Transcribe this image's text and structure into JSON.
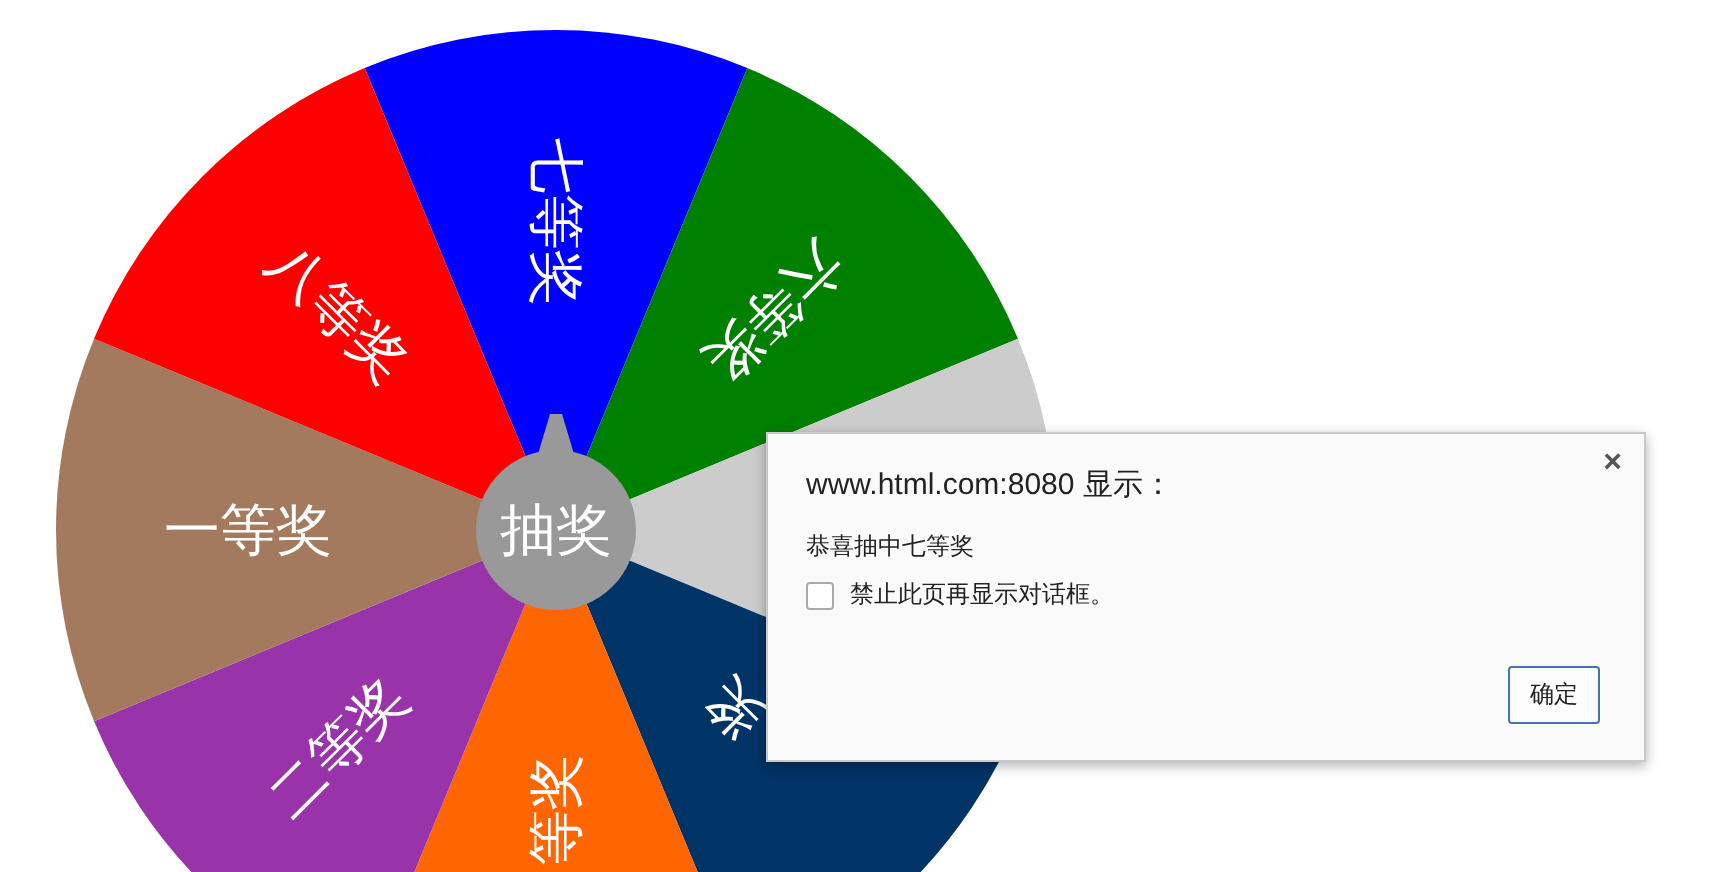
{
  "wheel": {
    "segments": [
      {
        "color": "#0000ff",
        "label": "七等奖"
      },
      {
        "color": "#008000",
        "label": "六等奖"
      },
      {
        "color": "#cccccc"
      },
      {
        "color": "#003366",
        "label": "奖"
      },
      {
        "color": "#ff6600",
        "label": "等奖"
      },
      {
        "color": "#9933aa",
        "label": "二等奖"
      },
      {
        "color": "#a47a5f",
        "label": "一等奖"
      },
      {
        "color": "#ff0000",
        "label": "八等奖"
      }
    ],
    "button": {
      "label": "抽奖"
    }
  },
  "dialog": {
    "title": "www.html.com:8080 显示：",
    "close": "×",
    "message": "恭喜抽中七等奖",
    "checkbox": {
      "label": "禁止此页再显示对话框。",
      "checked": false
    },
    "buttons": [
      "确定"
    ]
  }
}
